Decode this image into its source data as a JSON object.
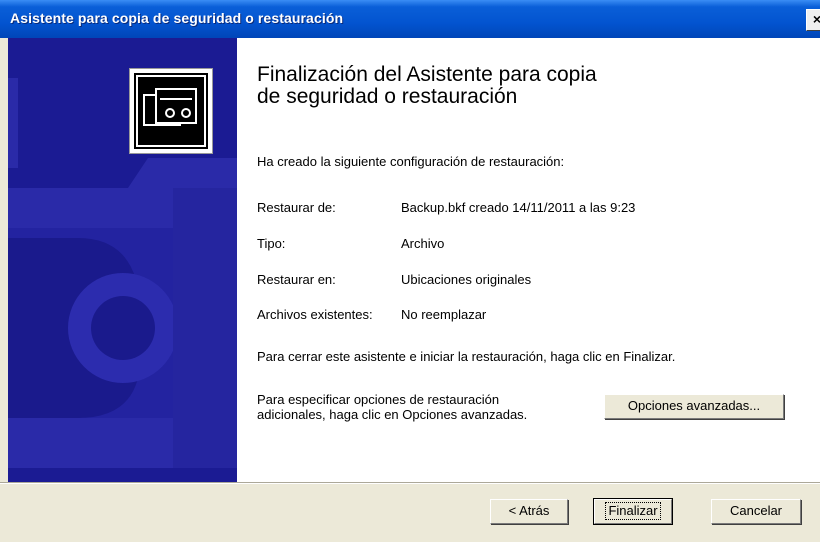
{
  "window": {
    "title": "Asistente para copia de seguridad o restauración",
    "close_label": "×"
  },
  "heading": {
    "line1": "Finalización del Asistente para copia",
    "line2": "de seguridad o restauración"
  },
  "intro": "Ha creado la siguiente configuración de restauración:",
  "summary": [
    {
      "label": "Restaurar de:",
      "value": "Backup.bkf creado 14/11/2011 a las 9:23"
    },
    {
      "label": "Tipo:",
      "value": "Archivo"
    },
    {
      "label": "Restaurar en:",
      "value": "Ubicaciones originales"
    },
    {
      "label": "Archivos existentes:",
      "value": "No reemplazar"
    }
  ],
  "finish_note": "Para cerrar este asistente e iniciar la restauración, haga clic en Finalizar.",
  "advanced_note": {
    "line1": "Para especificar opciones de restauración",
    "line2": "adicionales, haga clic en Opciones avanzadas."
  },
  "buttons": {
    "advanced": "Opciones avanzadas...",
    "back": "< Atrás",
    "finish": "Finalizar",
    "cancel": "Cancelar"
  },
  "colors": {
    "title_bar": "#0354d0",
    "side_panel": "#1b1b93",
    "window_bg": "#ece9d8"
  },
  "icons": [
    "backup-tape-icon",
    "close-icon"
  ]
}
